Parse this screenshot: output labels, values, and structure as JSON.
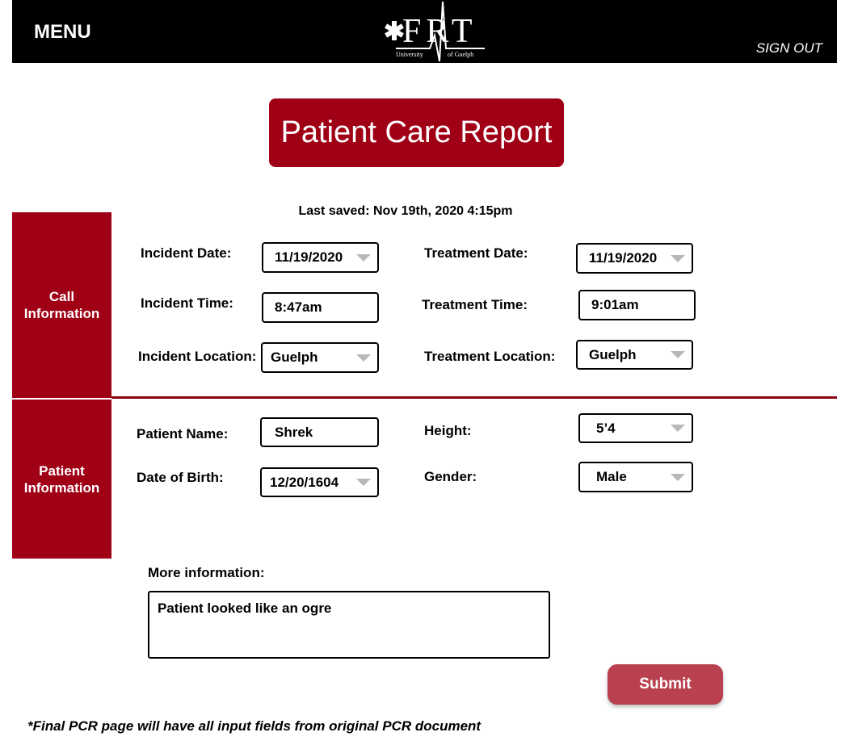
{
  "header": {
    "menu_label": "MENU",
    "signout_label": "SIGN OUT",
    "logo": {
      "letters": "FRT",
      "left_caption": "University",
      "right_caption": "of Guelph"
    }
  },
  "page": {
    "title": "Patient Care Report",
    "last_saved": "Last saved: Nov 19th, 2020 4:15pm"
  },
  "call_info": {
    "section_label": "Call Information",
    "incident_date_label": "Incident Date:",
    "incident_date": "11/19/2020",
    "incident_time_label": "Incident Time:",
    "incident_time": "8:47am",
    "incident_location_label": "Incident Location:",
    "incident_location": "Guelph",
    "treatment_date_label": "Treatment Date:",
    "treatment_date": "11/19/2020",
    "treatment_time_label": "Treatment Time:",
    "treatment_time": "9:01am",
    "treatment_location_label": "Treatment Location:",
    "treatment_location": "Guelph"
  },
  "patient_info": {
    "section_label": "Patient Information",
    "name_label": "Patient Name:",
    "name": "Shrek",
    "dob_label": "Date of Birth:",
    "dob": "12/20/1604",
    "height_label": "Height:",
    "height": "5’4",
    "gender_label": "Gender:",
    "gender": "Male"
  },
  "more_info": {
    "label": "More information:",
    "value": "Patient looked like an ogre"
  },
  "submit_label": "Submit",
  "footnote": "*Final PCR page will have all input fields from original PCR document",
  "colors": {
    "brand_red": "#a00016",
    "submit_red": "#b8404f",
    "header_black": "#000000"
  }
}
